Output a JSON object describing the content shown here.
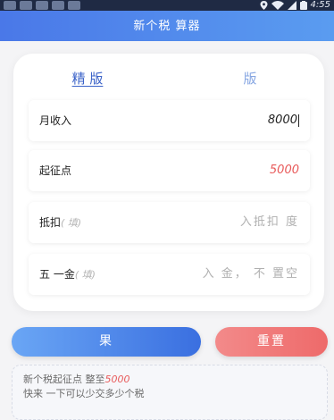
{
  "status_bar": {
    "time": "4:55"
  },
  "header": {
    "title": "新个税 算器"
  },
  "tabs": [
    {
      "label": "精 版"
    },
    {
      "label": "版"
    }
  ],
  "fields": {
    "income": {
      "label": "月收入",
      "value": "8000"
    },
    "threshold": {
      "label": "起征点",
      "value": "5000"
    },
    "deduction": {
      "label": "抵扣",
      "hint": "( 填)",
      "placeholder": "入抵扣 度"
    },
    "insurance": {
      "label": "五 一金",
      "hint": "( 填)",
      "placeholder": "入 金， 不 置空"
    }
  },
  "buttons": {
    "calculate": "果",
    "reset": "重置"
  },
  "notice": {
    "line1_prefix": "新个税起征点 整至",
    "line1_value": "5000",
    "line2": "快来  一下可以少交多少个税"
  },
  "colors": {
    "accent_blue": "#4a78e8",
    "accent_red": "#ee6a6a"
  }
}
